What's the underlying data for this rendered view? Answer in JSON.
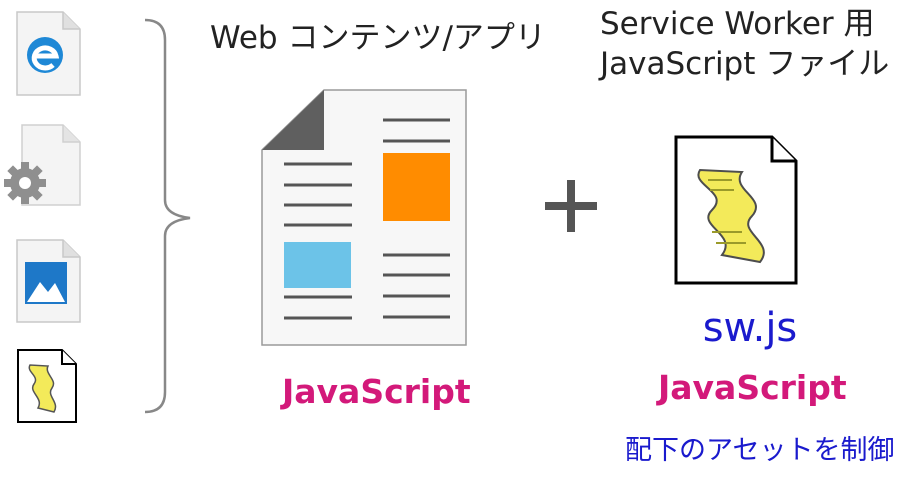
{
  "web_contents": {
    "title": "Web コンテンツ/アプリ",
    "language_label": "JavaScript"
  },
  "service_worker": {
    "title_line1": "Service Worker 用",
    "title_line2": "JavaScript ファイル",
    "filename": "sw.js",
    "language_label": "JavaScript",
    "caption": "配下のアセットを制御"
  },
  "plus_symbol": "+",
  "file_icons": [
    "edge-browser-icon",
    "gear-settings-icon",
    "image-file-icon",
    "script-file-icon"
  ],
  "colors": {
    "accent_pink": "#d3197a",
    "accent_blue": "#1a1acd",
    "orange_block": "#ff8c00",
    "blue_block": "#6cc3e8"
  }
}
